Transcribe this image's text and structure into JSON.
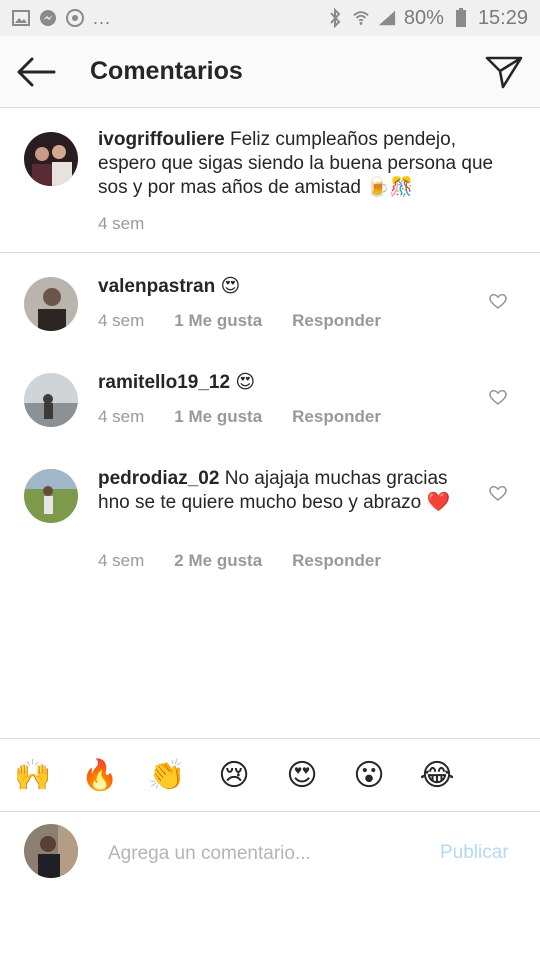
{
  "status_bar": {
    "battery": "80%",
    "time": "15:29",
    "overflow": "..."
  },
  "header": {
    "title": "Comentarios",
    "back_icon": "arrow-left-icon",
    "send_icon": "paper-plane-icon"
  },
  "caption": {
    "username": "ivogriffouliere",
    "text": "Feliz cumpleaños pendejo, espero que sigas siendo la buena persona que sos y por mas años de amistad 🍺🎊",
    "time": "4 sem"
  },
  "comments": [
    {
      "username": "valenpastran",
      "text": "😍",
      "time": "4 sem",
      "likes": "1 Me gusta",
      "reply": "Responder"
    },
    {
      "username": "ramitello19_12",
      "text": "😍",
      "time": "4 sem",
      "likes": "1 Me gusta",
      "reply": "Responder"
    },
    {
      "username": "pedrodiaz_02",
      "text": "No ajajaja muchas gracias hno se te quiere mucho beso y abrazo ❤️",
      "time": "4 sem",
      "likes": "2 Me gusta",
      "reply": "Responder"
    }
  ],
  "emoji_bar": [
    "🙌",
    "🔥",
    "👏",
    "😢",
    "😍",
    "😮",
    "😂"
  ],
  "composer": {
    "placeholder": "Agrega un comentario...",
    "publish_label": "Publicar"
  },
  "colors": {
    "status_bar_bg": "#f0f0f0",
    "header_bg": "#fafafa",
    "divider": "#dbdbdb",
    "meta_text": "#999999",
    "publish_disabled": "#b3d8f7"
  }
}
